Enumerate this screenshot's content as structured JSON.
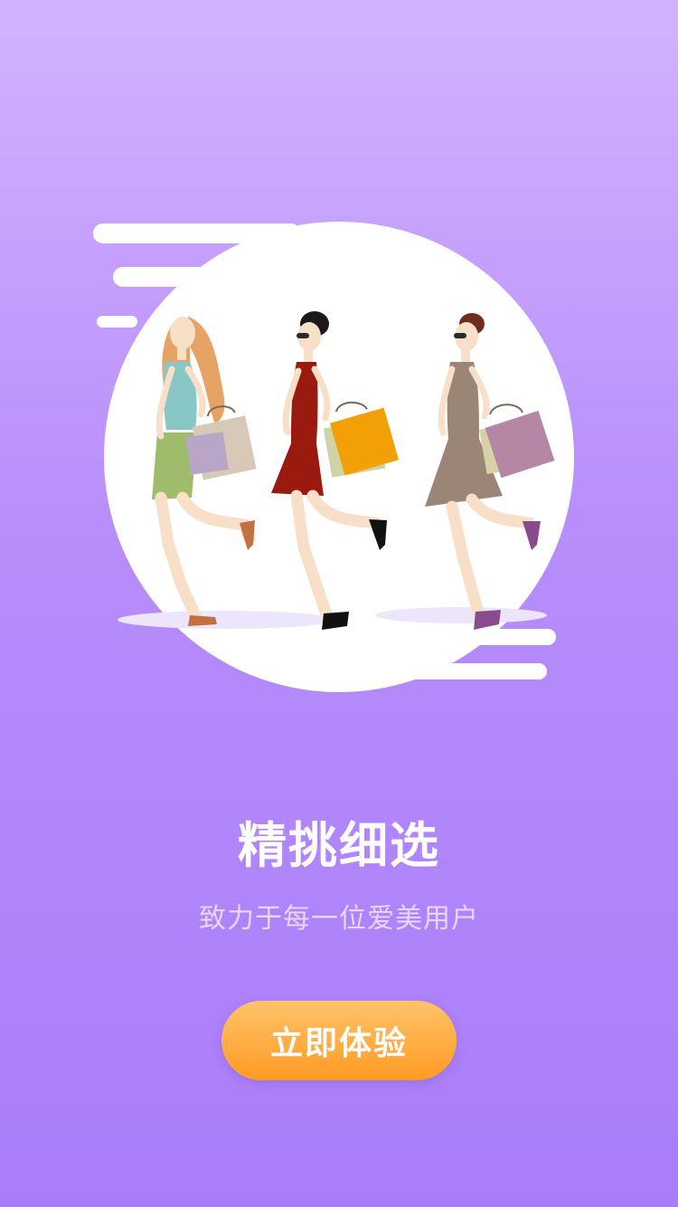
{
  "onboarding": {
    "title": "精挑细选",
    "subtitle": "致力于每一位爱美用户",
    "cta_label": "立即体验"
  },
  "illustration": {
    "subject": "three-women-shopping",
    "figures": [
      {
        "dress_color": "#9fbc6d",
        "top_color": "#88c7c6",
        "hair_color": "#e7a364",
        "bag_colors": [
          "#b9a6c6",
          "#d7c8b8"
        ]
      },
      {
        "dress_color": "#9b1a10",
        "hair_color": "#1a1a1a",
        "bag_colors": [
          "#f3a007",
          "#cfd3a6"
        ]
      },
      {
        "dress_color": "#9b8577",
        "hair_color": "#6d2e1e",
        "bag_colors": [
          "#b687a5",
          "#d8d1a7"
        ]
      }
    ]
  },
  "colors": {
    "background_top": "#d1b2ff",
    "background_bottom": "#a97dfa",
    "button_top": "#ffc36a",
    "button_bottom": "#ff9b24"
  }
}
